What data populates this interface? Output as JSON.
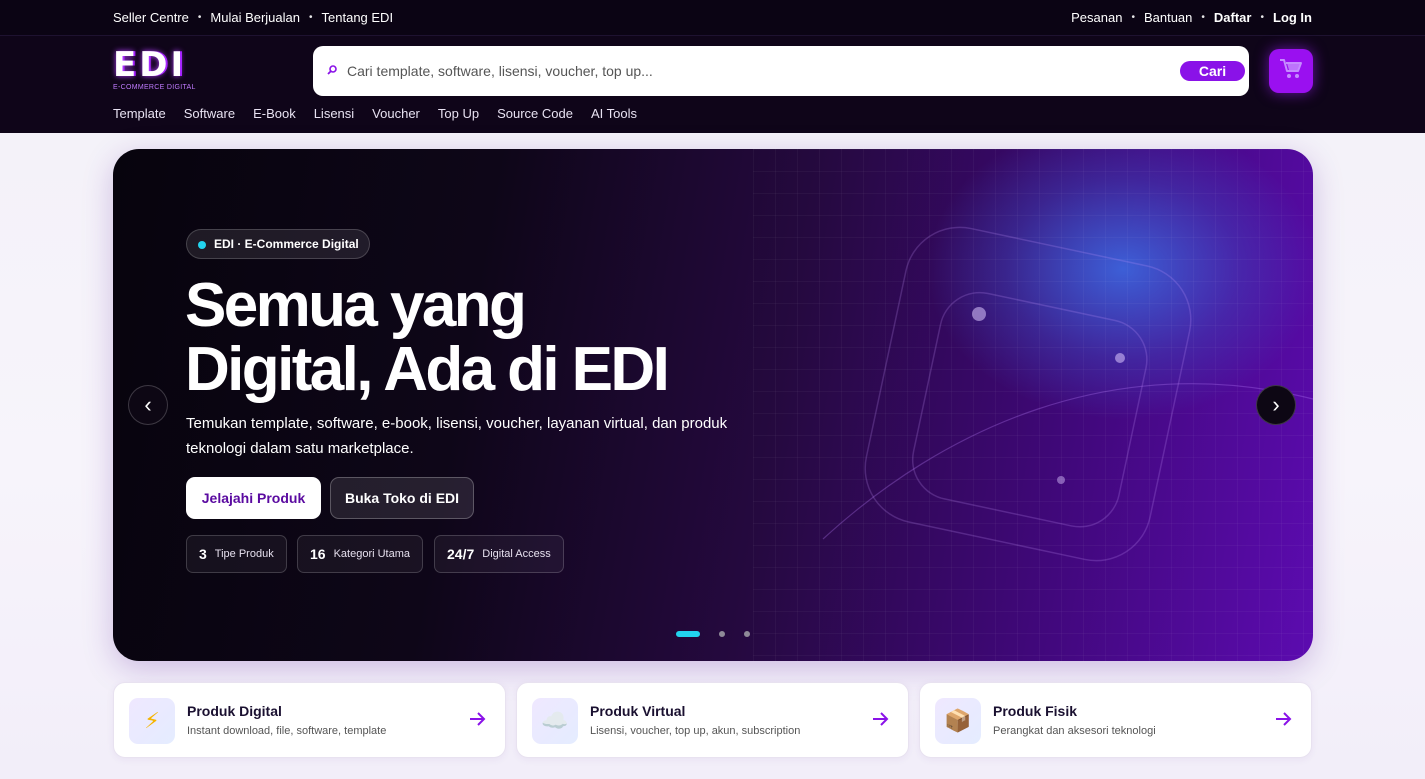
{
  "topbar": {
    "left": [
      "Seller Centre",
      "Mulai Berjualan",
      "Tentang EDI"
    ],
    "right": [
      "Pesanan",
      "Bantuan",
      "Daftar",
      "Log In"
    ],
    "separator": "•"
  },
  "header": {
    "logo_text": "EDI",
    "logo_tagline": "E-COMMERCE DIGITAL",
    "search_placeholder": "Cari template, software, lisensi, voucher, top up...",
    "search_button": "Cari",
    "cart_icon": "cart-icon",
    "nav": [
      "Template",
      "Software",
      "E-Book",
      "Lisensi",
      "Voucher",
      "Top Up",
      "Source Code",
      "AI Tools"
    ]
  },
  "hero": {
    "badge": "EDI · E-Commerce Digital",
    "headline_line1": "Semua yang",
    "headline_line2": "Digital, Ada di EDI",
    "subtitle": "Temukan template, software, e-book, lisensi, voucher, layanan virtual, dan produk teknologi dalam satu marketplace.",
    "cta_primary": "Jelajahi Produk",
    "cta_secondary": "Buka Toko di EDI",
    "stats": [
      {
        "number": "3",
        "label": "Tipe Produk"
      },
      {
        "number": "16",
        "label": "Kategori Utama"
      },
      {
        "number": "24/7",
        "label": "Digital Access"
      }
    ],
    "prev_arrow": "‹",
    "next_arrow": "›",
    "slide_count": 3,
    "active_slide": 1,
    "accent_color": "#22d3ee"
  },
  "categories": [
    {
      "title": "Produk Digital",
      "desc": "Instant download, file, software, template",
      "icon": "lightning-icon",
      "glyph": "⚡"
    },
    {
      "title": "Produk Virtual",
      "desc": "Lisensi, voucher, top up, akun, subscription",
      "icon": "cloud-icon",
      "glyph": "☁️"
    },
    {
      "title": "Produk Fisik",
      "desc": "Perangkat dan aksesori teknologi",
      "icon": "package-icon",
      "glyph": "📦"
    }
  ],
  "colors": {
    "brand": "#8a12e8",
    "topbar_bg": "#0b0414"
  }
}
